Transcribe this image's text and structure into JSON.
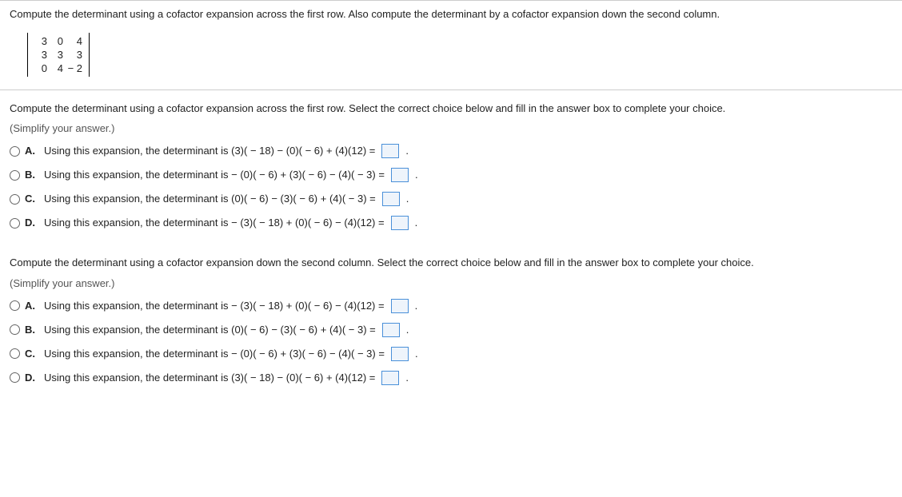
{
  "question": {
    "intro": "Compute the determinant using a cofactor expansion across the first row. Also compute the determinant by a cofactor expansion down the second column.",
    "matrix": [
      [
        "3",
        "0",
        "4"
      ],
      [
        "3",
        "3",
        "3"
      ],
      [
        "0",
        "4",
        "− 2"
      ]
    ]
  },
  "part1": {
    "instruction": "Compute the determinant using a cofactor expansion across the first row. Select the correct choice below and fill in the answer box to complete your choice.",
    "simplify": "(Simplify your answer.)",
    "choices": [
      {
        "letter": "A.",
        "text": "Using this expansion, the determinant is (3)( − 18) − (0)( − 6) + (4)(12) ="
      },
      {
        "letter": "B.",
        "text": "Using this expansion, the determinant is − (0)( − 6) + (3)( − 6) − (4)( − 3) ="
      },
      {
        "letter": "C.",
        "text": "Using this expansion, the determinant is (0)( − 6) − (3)( − 6) + (4)( − 3) ="
      },
      {
        "letter": "D.",
        "text": "Using this expansion, the determinant is − (3)( − 18) + (0)( − 6) − (4)(12) ="
      }
    ]
  },
  "part2": {
    "instruction": "Compute the determinant using a cofactor expansion down the second column. Select the correct choice below and fill in the answer box to complete your choice.",
    "simplify": "(Simplify your answer.)",
    "choices": [
      {
        "letter": "A.",
        "text": "Using this expansion, the determinant is − (3)( − 18) + (0)( − 6) − (4)(12) ="
      },
      {
        "letter": "B.",
        "text": "Using this expansion, the determinant is (0)( − 6) − (3)( − 6) + (4)( − 3) ="
      },
      {
        "letter": "C.",
        "text": "Using this expansion, the determinant is − (0)( − 6) + (3)( − 6) − (4)( − 3) ="
      },
      {
        "letter": "D.",
        "text": "Using this expansion, the determinant is (3)( − 18) − (0)( − 6) + (4)(12) ="
      }
    ]
  },
  "period": "."
}
